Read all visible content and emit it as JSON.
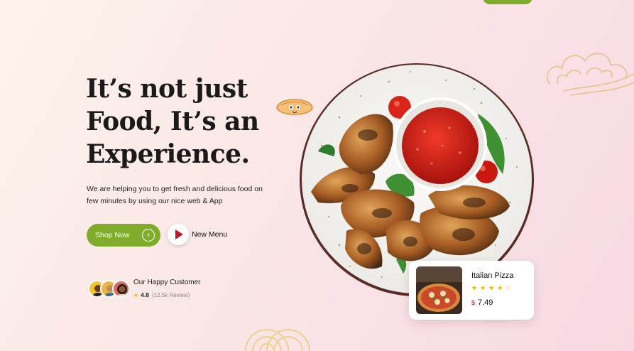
{
  "hero": {
    "title_line1": "It’s not just",
    "title_line2": "Food, It’s an",
    "title_line3": "Experience.",
    "description": "We are helping you to get fresh and delicious food on few minutes by using our nice web & App"
  },
  "actions": {
    "shop_label": "Shop Now",
    "menu_label": "New Menu"
  },
  "customers": {
    "title": "Our Happy Customer",
    "rating": "4.8",
    "reviews": "(12.5k Review)"
  },
  "product_card": {
    "name": "Italian Pizza",
    "rating_stars": 4,
    "currency": "$",
    "price": "7.49"
  },
  "colors": {
    "accent": "#7fad2b",
    "play": "#c0162a",
    "star": "#f5b400"
  }
}
